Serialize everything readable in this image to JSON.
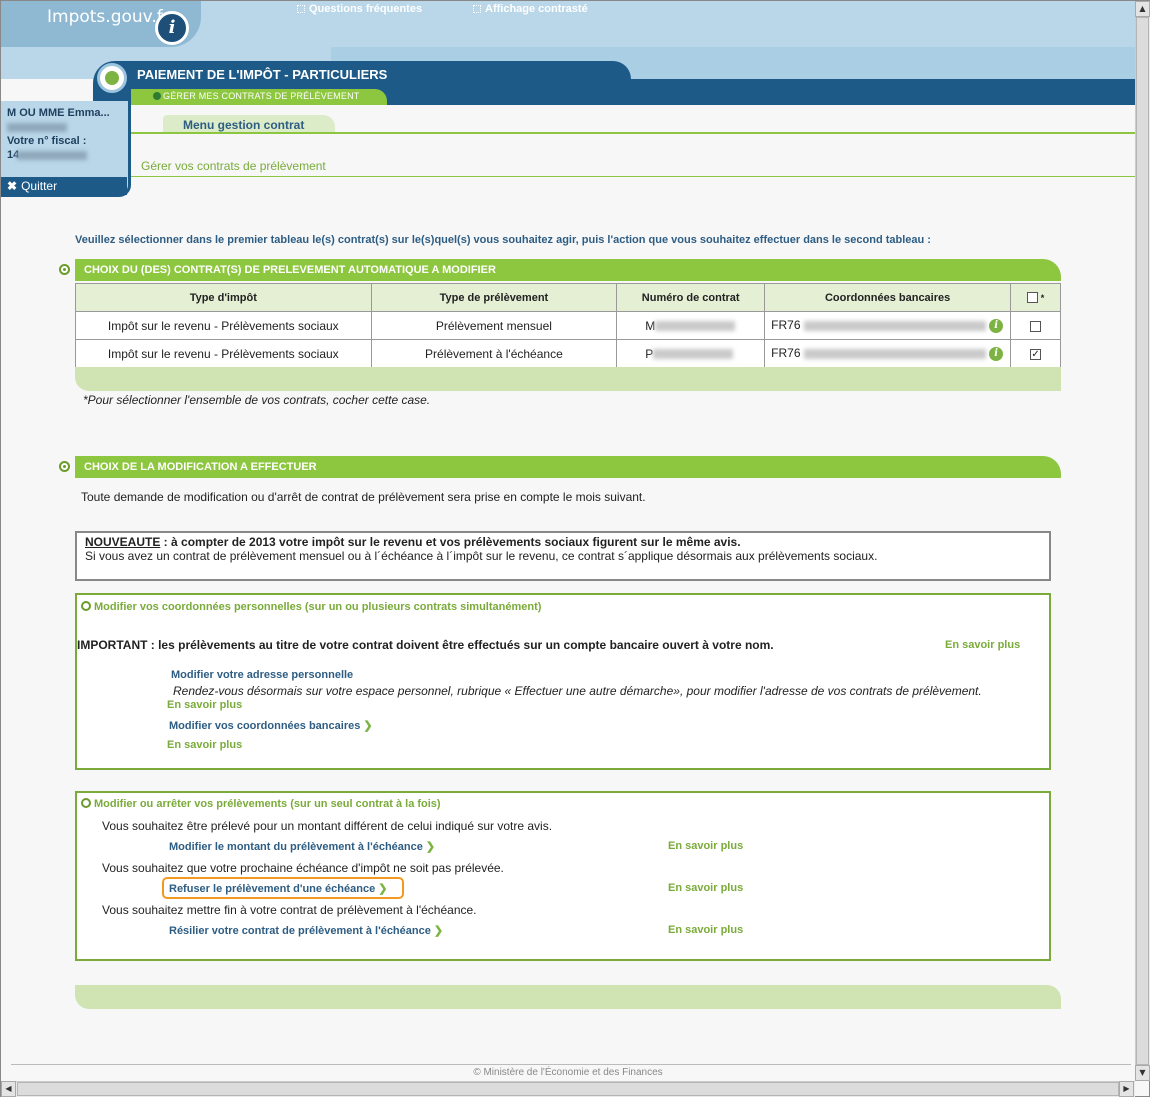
{
  "header": {
    "logo_text": "Impots.gouv.fr",
    "logo_badge": "i",
    "links": [
      "Questions fréquentes",
      "Affichage contrasté"
    ],
    "title": "PAIEMENT DE L'IMPÔT - PARTICULIERS",
    "subtab": "GÉRER MES CONTRATS DE PRÉLÈVEMENT"
  },
  "user": {
    "name": "M OU MME Emma...",
    "fiscal_label": "Votre n° fiscal :",
    "fiscal_value": "14",
    "quit_label": "Quitter"
  },
  "menu": {
    "tab_label": "Menu gestion contrat",
    "subtitle": "Gérer vos contrats de prélèvement"
  },
  "instructions": "Veuillez sélectionner dans le premier tableau le(s) contrat(s) sur le(s)quel(s) vous souhaitez agir, puis l'action que vous souhaitez effectuer dans le second tableau :",
  "section1": {
    "title": "CHOIX DU (DES) CONTRAT(S) DE PRELEVEMENT AUTOMATIQUE A MODIFIER",
    "columns": [
      "Type d'impôt",
      "Type de prélèvement",
      "Numéro de contrat",
      "Coordonnées bancaires",
      "*"
    ],
    "rows": [
      {
        "type_impot": "Impôt sur le revenu - Prélèvements sociaux",
        "type_prel": "Prélèvement mensuel",
        "contrat": "M",
        "iban": "FR76",
        "checked": false
      },
      {
        "type_impot": "Impôt sur le revenu - Prélèvements sociaux",
        "type_prel": "Prélèvement à l'échéance",
        "contrat": "P",
        "iban": "FR76",
        "checked": true
      }
    ],
    "footnote": "*Pour sélectionner l'ensemble de vos contrats, cocher cette case."
  },
  "section2": {
    "title": "CHOIX DE LA MODIFICATION A EFFECTUER",
    "notice": "Toute demande de modification ou d'arrêt de contrat de prélèvement sera prise en compte le mois suivant.",
    "nouveaute_label": "NOUVEAUTE",
    "nouveaute_text": " : à compter de 2013 votre impôt sur le revenu et vos prélèvements sociaux figurent sur le même avis.",
    "nouveaute_line2": "Si vous avez un contrat de prélèvement mensuel ou à l´échéance à l´impôt sur le revenu, ce contrat s´applique désormais aux prélèvements sociaux."
  },
  "group1": {
    "title": "Modifier vos coordonnées personnelles (sur un ou plusieurs contrats simultanément)",
    "important": "IMPORTANT : les prélèvements au titre de votre contrat doivent être effectués sur un compte bancaire ouvert à votre nom.",
    "savoir_plus": "En savoir plus",
    "link_adresse": "Modifier votre adresse personnelle",
    "adresse_text": "Rendez-vous désormais sur votre espace personnel, rubrique « Effectuer une autre démarche», pour modifier l'adresse de vos contrats de prélèvement.",
    "savoir_plus_2": "En savoir plus",
    "link_bancaires": "Modifier vos coordonnées bancaires",
    "savoir_plus_3": "En savoir plus"
  },
  "group2": {
    "title": "Modifier ou arrêter vos prélèvements (sur un seul contrat à la fois)",
    "text1": "Vous souhaitez être prélevé pour un montant différent de celui indiqué sur votre avis.",
    "link1": "Modifier le montant du prélèvement à l'échéance",
    "text2": "Vous souhaitez que votre prochaine échéance d'impôt ne soit pas prélevée.",
    "link2": "Refuser le prélèvement d'une échéance",
    "text3": "Vous souhaitez mettre fin à votre contrat de prélèvement à l'échéance.",
    "link3": "Résilier votre contrat de prélèvement à l'échéance",
    "savoir_plus": "En savoir plus"
  },
  "footer": {
    "copyright": "© Ministère de l'Économie et des Finances"
  },
  "colors": {
    "brand_blue": "#1e5a88",
    "light_blue": "#b9d7e9",
    "green": "#8dc63f",
    "highlight_orange": "#f29a1f"
  }
}
